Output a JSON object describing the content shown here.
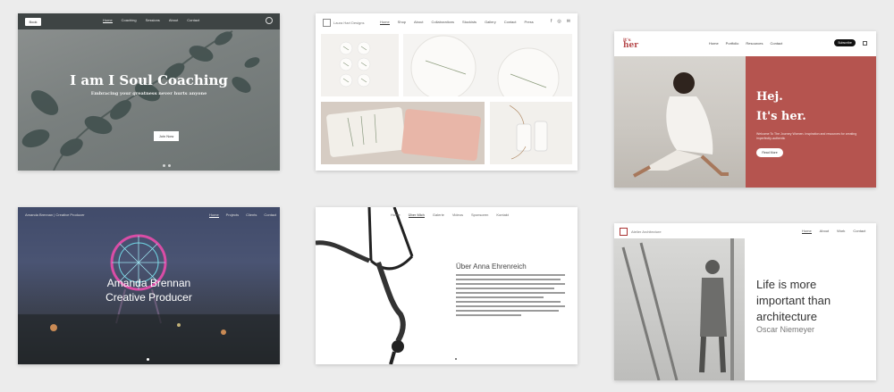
{
  "card1": {
    "nav_button": "Book",
    "nav_links": [
      "Home",
      "Coaching",
      "Sessions",
      "About",
      "Contact"
    ],
    "title": "I am I Soul Coaching",
    "subtitle": "Embracing your greatness never hurts anyone",
    "cta": "Join Now"
  },
  "card2": {
    "brand": "Laura Hart Designs",
    "nav_links": [
      "Home",
      "Shop",
      "About",
      "Collaborations",
      "Stockists",
      "Gallery",
      "Contact",
      "Press"
    ],
    "social": [
      "f",
      "◎",
      "✉"
    ]
  },
  "card3": {
    "logo_top": "it's",
    "logo_bottom": "her",
    "nav_links": [
      "Home",
      "Portfolio",
      "Resources",
      "Contact"
    ],
    "pill": "Subscribe",
    "heading_1": "Hej.",
    "heading_2": "It's her.",
    "copy": "Welcome To The Journey Women. Inspiration and resources for creating imperfectly-authentic",
    "button": "Read More"
  },
  "card4": {
    "brand": "Amanda Brennan | Creative Producer",
    "nav_links": [
      "Home",
      "Projects",
      "Clients",
      "Contact"
    ],
    "title_1": "Amanda Brennan",
    "title_2": "Creative Producer"
  },
  "card5": {
    "nav_links": [
      "Home",
      "Über Mich",
      "Galerie",
      "Videos",
      "Sponsoren",
      "Kontakt"
    ],
    "heading": "Über Anna Ehrenreich"
  },
  "card6": {
    "brand": "Atelier Architecture",
    "nav_links": [
      "Home",
      "About",
      "Work",
      "Contact"
    ],
    "quote_1": "Life is more",
    "quote_2": "important than",
    "quote_3": "architecture",
    "author": "Oscar Niemeyer"
  }
}
